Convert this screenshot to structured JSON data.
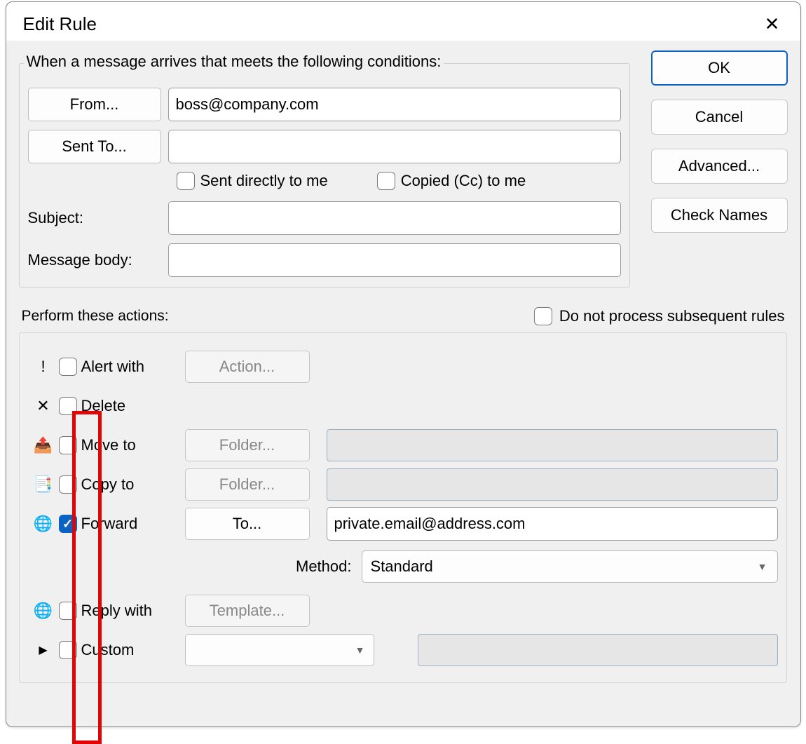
{
  "title": "Edit Rule",
  "buttons": {
    "ok": "OK",
    "cancel": "Cancel",
    "advanced": "Advanced...",
    "checkNames": "Check Names"
  },
  "conditions": {
    "legend": "When a message arrives that meets the following conditions:",
    "fromBtn": "From...",
    "fromValue": "boss@company.com",
    "sentToBtn": "Sent To...",
    "sentToValue": "",
    "sentDirectly": "Sent directly to me",
    "copiedCc": "Copied (Cc) to me",
    "subjectLabel": "Subject:",
    "subjectValue": "",
    "bodyLabel": "Message body:",
    "bodyValue": ""
  },
  "actionsHeader": "Perform these actions:",
  "noSubsequent": "Do not process subsequent rules",
  "actions": {
    "alert": {
      "label": "Alert with",
      "btn": "Action..."
    },
    "delete": {
      "label": "Delete"
    },
    "move": {
      "label": "Move to",
      "btn": "Folder..."
    },
    "copy": {
      "label": "Copy to",
      "btn": "Folder..."
    },
    "forward": {
      "label": "Forward",
      "btn": "To...",
      "value": "private.email@address.com"
    },
    "methodLabel": "Method:",
    "methodValue": "Standard",
    "reply": {
      "label": "Reply with",
      "btn": "Template..."
    },
    "custom": {
      "label": "Custom"
    }
  },
  "icons": {
    "alert": "!",
    "delete": "✕",
    "move": "📤",
    "copy": "📑",
    "forward": "🌐",
    "reply": "🌐",
    "custom": "▶"
  }
}
